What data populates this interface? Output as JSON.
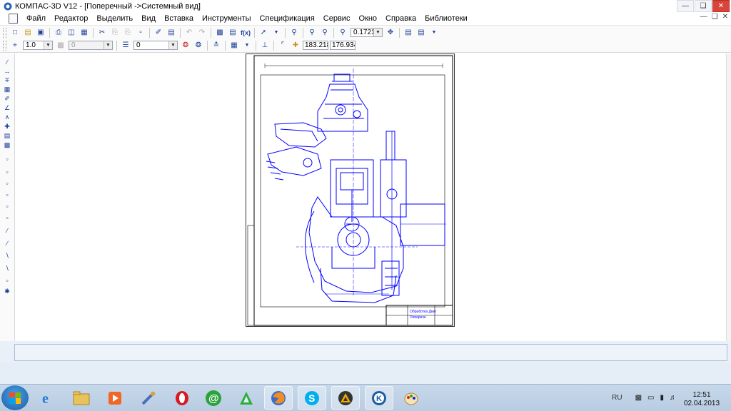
{
  "window": {
    "title": "КОМПАС-3D V12 - [Поперечный ->Системный вид]",
    "controls": [
      "minimize",
      "restore",
      "close"
    ]
  },
  "menu": {
    "items": [
      "Файл",
      "Редактор",
      "Выделить",
      "Вид",
      "Вставка",
      "Инструменты",
      "Спецификация",
      "Сервис",
      "Окно",
      "Справка",
      "Библиотеки"
    ]
  },
  "toolbar1": {
    "zoom_value": "0.1721"
  },
  "toolbar2": {
    "line_width": "1.0",
    "layer_value": "0",
    "style_value": "0",
    "coord_x": "183.218",
    "coord_y": "176.934"
  },
  "drawing": {
    "title_block_line1": "Обработка Двиг",
    "title_block_line2": "Поперечн",
    "line_color": "#0000ff"
  },
  "taskbar": {
    "language": "RU",
    "time": "12:51",
    "date": "02.04.2013",
    "apps": [
      "windows-explorer",
      "internet-explorer",
      "file-folder",
      "media-player",
      "tool-app",
      "opera",
      "mail-agent",
      "acrobat",
      "firefox",
      "skype",
      "kompas-3d-a",
      "kompas-3d-k",
      "paint"
    ]
  }
}
